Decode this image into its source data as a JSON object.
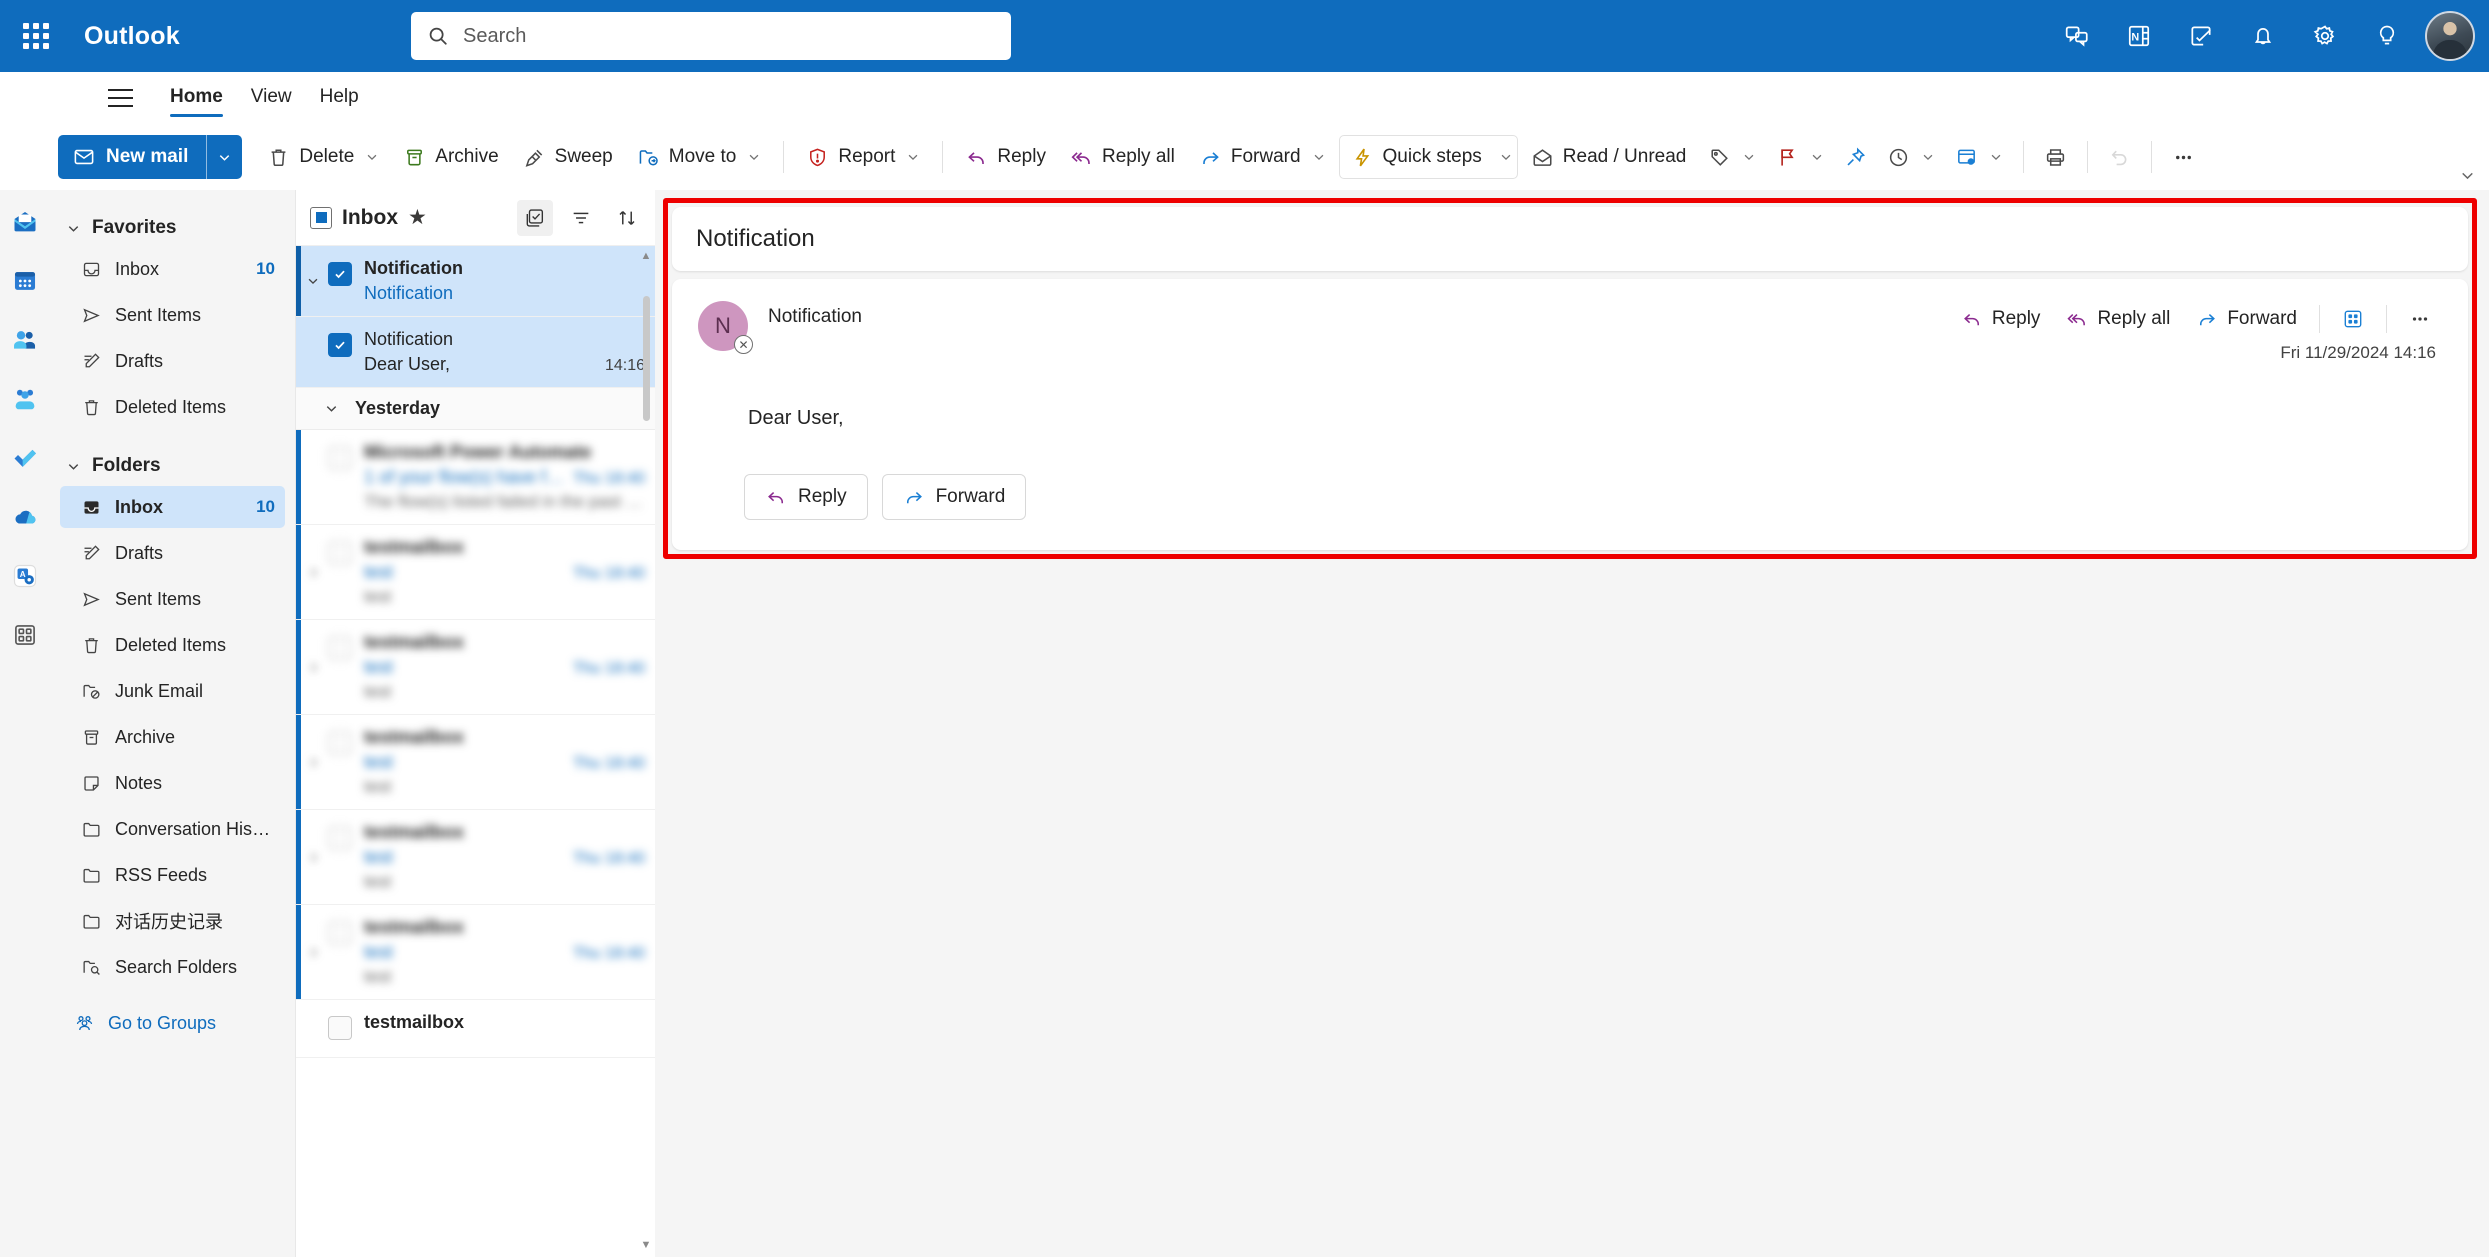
{
  "topbar": {
    "app_launcher": "waffle-grid",
    "brand": "Outlook",
    "search_placeholder": "Search",
    "icons": [
      "chat-icon",
      "onenote-icon",
      "to-do-icon",
      "bell-icon",
      "gear-icon",
      "lightbulb-icon"
    ]
  },
  "tabs": [
    {
      "label": "Home",
      "active": true
    },
    {
      "label": "View",
      "active": false
    },
    {
      "label": "Help",
      "active": false
    }
  ],
  "ribbon": {
    "new_mail": "New mail",
    "items": [
      {
        "label": "Delete",
        "icon": "trash-icon",
        "caret": true
      },
      {
        "label": "Archive",
        "icon": "archive-icon",
        "caret": false
      },
      {
        "label": "Sweep",
        "icon": "broom-icon",
        "caret": false
      },
      {
        "label": "Move to",
        "icon": "move-folder-icon",
        "caret": true
      },
      {
        "label": "Report",
        "icon": "report-shield-icon",
        "caret": true
      },
      {
        "label": "Reply",
        "icon": "reply-icon",
        "caret": false
      },
      {
        "label": "Reply all",
        "icon": "reply-all-icon",
        "caret": false
      },
      {
        "label": "Forward",
        "icon": "forward-icon",
        "caret": true
      },
      {
        "label": "Quick steps",
        "icon": "lightning-icon",
        "caret": true
      },
      {
        "label": "Read / Unread",
        "icon": "envelope-open-icon",
        "caret": false
      }
    ],
    "icon_only": [
      "tag-icon",
      "flag-icon",
      "pin-icon",
      "clock-icon",
      "rules-icon",
      "print-icon",
      "undo-icon",
      "more-ellipsis-icon"
    ]
  },
  "rail": {
    "items": [
      "mail-icon",
      "calendar-icon",
      "people-icon",
      "teams-icon",
      "to-do-check-icon",
      "onedrive-cloud-icon",
      "apps-gear-icon",
      "more-apps-icon"
    ]
  },
  "sidebar": {
    "favorites": {
      "label": "Favorites",
      "items": [
        {
          "label": "Inbox",
          "icon": "inbox-icon",
          "count": "10"
        },
        {
          "label": "Sent Items",
          "icon": "send-icon",
          "count": ""
        },
        {
          "label": "Drafts",
          "icon": "draft-pencil-icon",
          "count": ""
        },
        {
          "label": "Deleted Items",
          "icon": "trash-icon",
          "count": ""
        }
      ]
    },
    "folders": {
      "label": "Folders",
      "items": [
        {
          "label": "Inbox",
          "icon": "inbox-icon",
          "count": "10",
          "selected": true
        },
        {
          "label": "Drafts",
          "icon": "draft-pencil-icon",
          "count": "",
          "selected": false
        },
        {
          "label": "Sent Items",
          "icon": "send-icon",
          "count": "",
          "selected": false
        },
        {
          "label": "Deleted Items",
          "icon": "trash-icon",
          "count": "",
          "selected": false
        },
        {
          "label": "Junk Email",
          "icon": "junk-icon",
          "count": "",
          "selected": false
        },
        {
          "label": "Archive",
          "icon": "archive-icon",
          "count": "",
          "selected": false
        },
        {
          "label": "Notes",
          "icon": "note-icon",
          "count": "",
          "selected": false
        },
        {
          "label": "Conversation Histo...",
          "icon": "folder-icon",
          "count": "",
          "selected": false
        },
        {
          "label": "RSS Feeds",
          "icon": "folder-icon",
          "count": "",
          "selected": false
        },
        {
          "label": "对话历史记录",
          "icon": "folder-icon",
          "count": "",
          "selected": false
        },
        {
          "label": "Search Folders",
          "icon": "search-folder-icon",
          "count": "",
          "selected": false
        }
      ]
    },
    "go_to_groups": "Go to Groups"
  },
  "message_list": {
    "title": "Inbox",
    "favorite_star": "★",
    "header_icons": [
      "select-all-icon",
      "filter-icon",
      "sort-icon"
    ],
    "day_separator": "Yesterday",
    "items": [
      {
        "from": "Notification",
        "subject": "Notification",
        "preview": "",
        "time": "",
        "selected": true,
        "checked": true,
        "blurred": false,
        "lead": true,
        "twisty": true
      },
      {
        "from": "Notification",
        "subject": "Dear User,",
        "preview": "",
        "time": "14:16",
        "selected": true,
        "checked": true,
        "blurred": false,
        "lead": false,
        "twisty": false
      },
      {
        "from": "Microsoft Power Automate",
        "subject": "1 of your flow(s) have fail...",
        "preview": "The flow(s) listed failed in the past w...",
        "time": "Thu 18:40",
        "selected": false,
        "checked": false,
        "blurred": true,
        "lead": false,
        "twisty": false
      },
      {
        "from": "testmailbox",
        "subject": "test",
        "preview": "test",
        "time": "Thu 18:40",
        "selected": false,
        "checked": false,
        "blurred": true,
        "lead": false,
        "twisty": true
      },
      {
        "from": "testmailbox",
        "subject": "test",
        "preview": "test",
        "time": "Thu 18:40",
        "selected": false,
        "checked": false,
        "blurred": true,
        "lead": false,
        "twisty": true
      },
      {
        "from": "testmailbox",
        "subject": "test",
        "preview": "test",
        "time": "Thu 18:40",
        "selected": false,
        "checked": false,
        "blurred": true,
        "lead": false,
        "twisty": true
      },
      {
        "from": "testmailbox",
        "subject": "test",
        "preview": "test",
        "time": "Thu 18:40",
        "selected": false,
        "checked": false,
        "blurred": true,
        "lead": false,
        "twisty": true
      },
      {
        "from": "testmailbox",
        "subject": "test",
        "preview": "test",
        "time": "Thu 18:40",
        "selected": false,
        "checked": false,
        "blurred": true,
        "lead": false,
        "twisty": true
      },
      {
        "from": "testmailbox",
        "subject": "",
        "preview": "",
        "time": "",
        "selected": false,
        "checked": false,
        "blurred": false,
        "lead": false,
        "twisty": false
      }
    ]
  },
  "reading_pane": {
    "highlight_color": "#ee0000",
    "subject": "Notification",
    "sender_initial": "N",
    "sender_name": "Notification",
    "timestamp": "Fri 11/29/2024 14:16",
    "body": "Dear User,",
    "actions": [
      {
        "label": "Reply",
        "icon": "reply-icon"
      },
      {
        "label": "Reply all",
        "icon": "reply-all-icon"
      },
      {
        "label": "Forward",
        "icon": "forward-icon"
      }
    ],
    "action_icons": [
      "apps-grid-icon",
      "more-ellipsis-icon"
    ],
    "quick_replies": [
      {
        "label": "Reply",
        "icon": "reply-icon"
      },
      {
        "label": "Forward",
        "icon": "forward-icon"
      }
    ]
  }
}
